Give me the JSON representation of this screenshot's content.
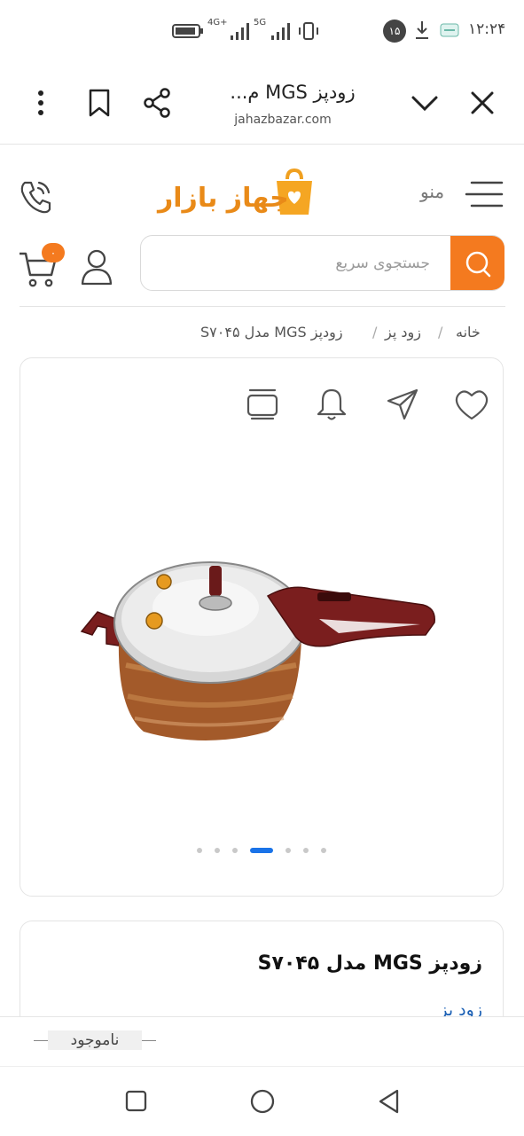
{
  "status_bar": {
    "time": "۱۲:۲۴",
    "notification_count": "۱۵",
    "network_1": "4G+",
    "network_2": "5G"
  },
  "browser": {
    "title": "زودپز MGS م...",
    "url": "jahazbazar.com"
  },
  "site": {
    "menu_label": "منو",
    "logo_text": "جهاز بازار",
    "cart_count": "۰"
  },
  "search": {
    "placeholder": "جستجوی سریع"
  },
  "breadcrumb": {
    "home": "خانه",
    "sep": "/",
    "category": "زود پز",
    "current": "زودپز MGS مدل S۷۰۴۵"
  },
  "product": {
    "title": "زودپز MGS مدل S۷۰۴۵",
    "category_link": "زود پز",
    "availability": "ناموجود"
  },
  "gallery": {
    "dot_count": 7,
    "active_dot": 3
  },
  "colors": {
    "accent": "#f47a1f",
    "link": "#1a5fb4",
    "active_dot": "#1a73e8"
  }
}
